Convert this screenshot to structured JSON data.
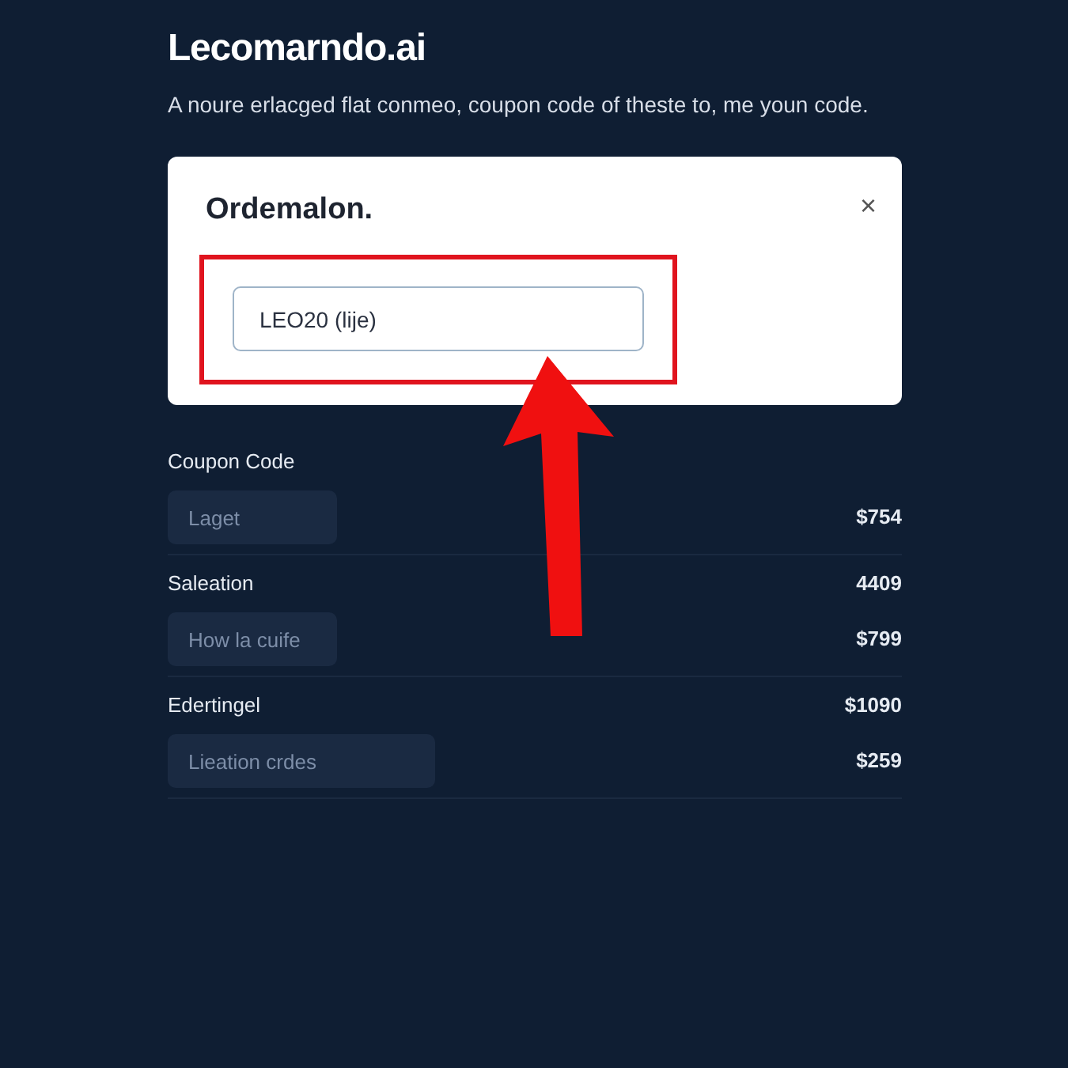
{
  "header": {
    "brand": "Lecomarndo.ai",
    "subtitle": "A noure erlacged flat conmeo, coupon code of theste to, me youn code."
  },
  "dialog": {
    "title": "Ordemalon.",
    "close": "×",
    "coupon_value": "LEO20 (lije)",
    "highlighted": true
  },
  "sections": [
    {
      "label": "Coupon Code",
      "placeholder": "Laget",
      "kind": "narrow",
      "field_amount": "$754"
    },
    {
      "label": "Saleation",
      "label_amount": "4409",
      "placeholder": "How la cuife",
      "kind": "narrow",
      "field_amount": "$799"
    },
    {
      "label": "Edertingel",
      "label_amount": "$1090",
      "placeholder": "Lieation crdes",
      "kind": "wide",
      "field_amount": "$259"
    }
  ]
}
